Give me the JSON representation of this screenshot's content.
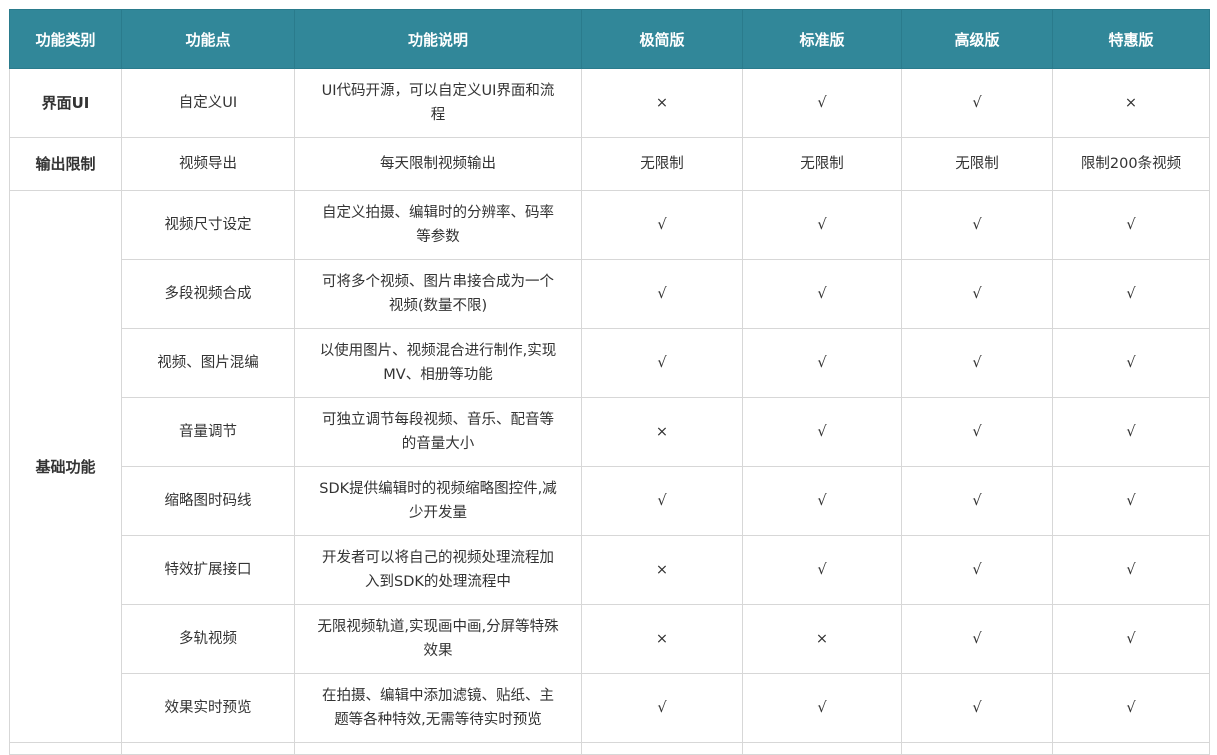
{
  "headers": [
    "功能类别",
    "功能点",
    "功能说明",
    "极简版",
    "标准版",
    "高级版",
    "特惠版"
  ],
  "rows": [
    {
      "category": "界面UI",
      "feature": "自定义UI",
      "description": "UI代码开源，可以自定义UI界面和流程",
      "values": [
        "×",
        "√",
        "√",
        "×"
      ]
    },
    {
      "category": "输出限制",
      "feature": "视频导出",
      "description": "每天限制视频输出",
      "values": [
        "无限制",
        "无限制",
        "无限制",
        "限制200条视频"
      ]
    }
  ],
  "basic_group": {
    "category": "基础功能",
    "rows": [
      {
        "feature": "视频尺寸设定",
        "description": "自定义拍摄、编辑时的分辨率、码率等参数",
        "values": [
          "√",
          "√",
          "√",
          "√"
        ]
      },
      {
        "feature": "多段视频合成",
        "description": "可将多个视频、图片串接合成为一个视频(数量不限)",
        "values": [
          "√",
          "√",
          "√",
          "√"
        ]
      },
      {
        "feature": "视频、图片混编",
        "description": "以使用图片、视频混合进行制作,实现MV、相册等功能",
        "values": [
          "√",
          "√",
          "√",
          "√"
        ]
      },
      {
        "feature": "音量调节",
        "description": "可独立调节每段视频、音乐、配音等的音量大小",
        "values": [
          "×",
          "√",
          "√",
          "√"
        ]
      },
      {
        "feature": "缩略图时码线",
        "description": "SDK提供编辑时的视频缩略图控件,减少开发量",
        "values": [
          "√",
          "√",
          "√",
          "√"
        ]
      },
      {
        "feature": "特效扩展接口",
        "description": "开发者可以将自己的视频处理流程加入到SDK的处理流程中",
        "values": [
          "×",
          "√",
          "√",
          "√"
        ]
      },
      {
        "feature": "多轨视频",
        "description": "无限视频轨道,实现画中画,分屏等特殊效果",
        "values": [
          "×",
          "×",
          "√",
          "√"
        ]
      },
      {
        "feature": "效果实时预览",
        "description": "在拍摄、编辑中添加滤镜、贴纸、主题等各种特效,无需等待实时预览",
        "values": [
          "√",
          "√",
          "√",
          "√"
        ]
      }
    ]
  }
}
